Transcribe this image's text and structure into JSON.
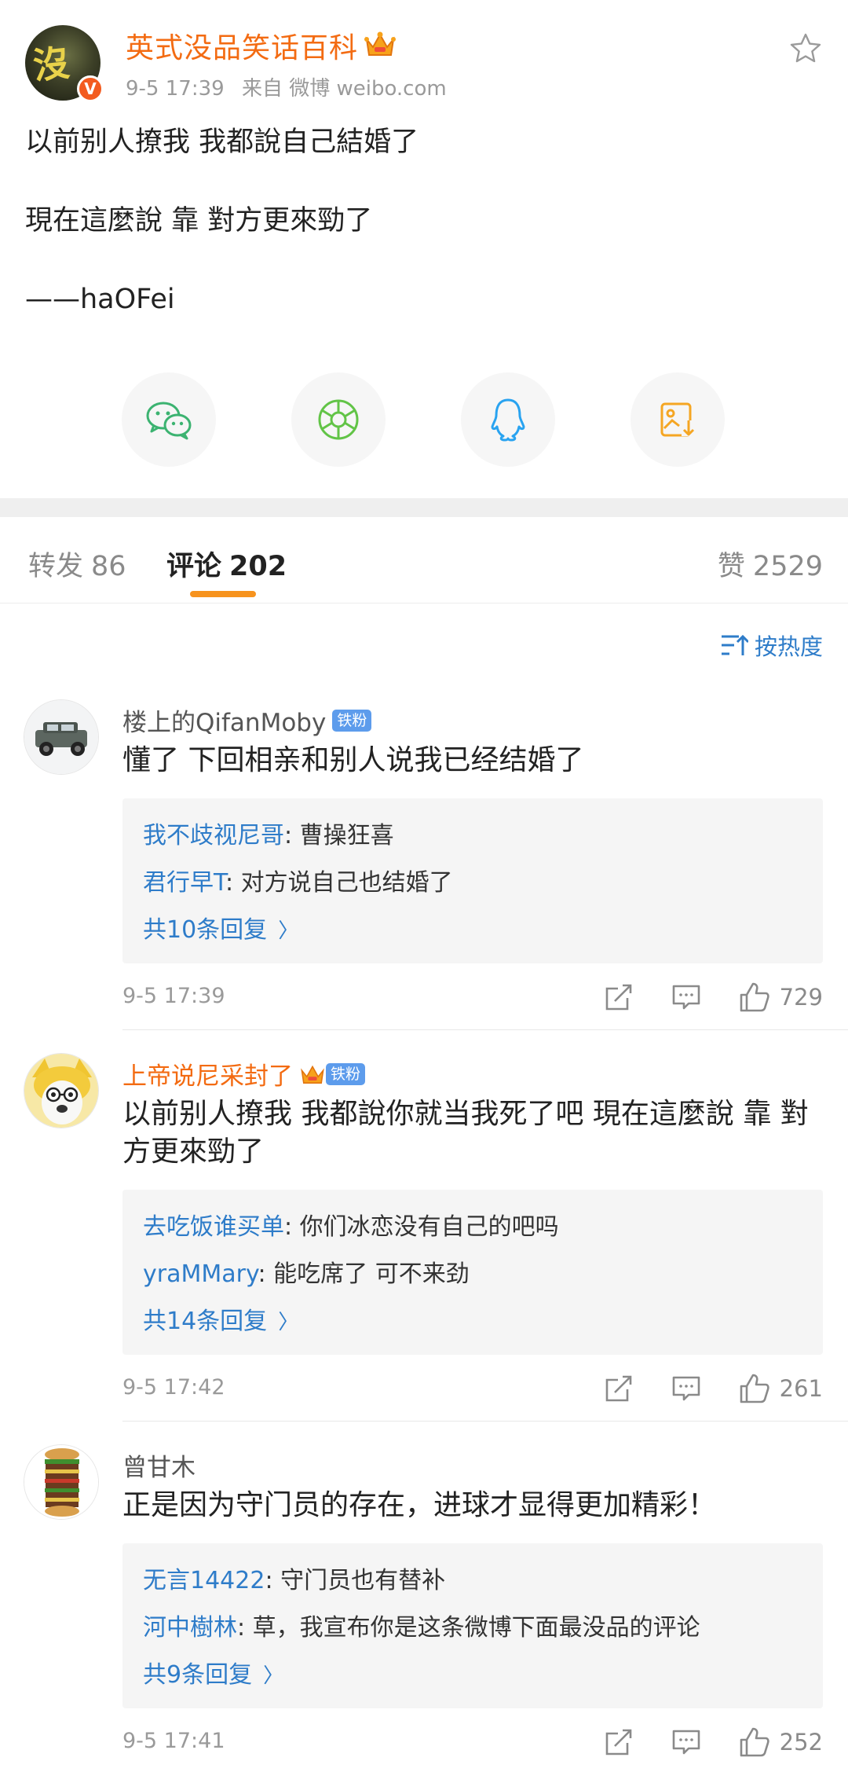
{
  "post": {
    "author": "英式没品笑话百科",
    "verified_mark": "V",
    "time": "9-5 17:39",
    "source": "来自 微博 weibo.com",
    "lines": [
      "以前别人撩我 我都說自己結婚了",
      "現在這麼說 靠 對方更來勁了",
      "——haOFei"
    ],
    "avatar_glyph": "沒",
    "icons": {
      "crown": "crown-icon",
      "star": "star-outline-icon"
    }
  },
  "share": [
    {
      "icon": "wechat-icon",
      "color": "#3cb371"
    },
    {
      "icon": "moments-icon",
      "color": "#62c447"
    },
    {
      "icon": "qq-icon",
      "color": "#29a3f0"
    },
    {
      "icon": "save-image-icon",
      "color": "#f5a623"
    }
  ],
  "tabs": {
    "repost_label": "转发",
    "repost_count": "86",
    "comment_label": "评论",
    "comment_count": "202",
    "like_label": "赞",
    "like_count": "2529"
  },
  "sort_label": "按热度",
  "colors": {
    "accent_orange": "#f7931e",
    "link_blue": "#2e7cc9",
    "name_orange": "#f36b12"
  },
  "comments": [
    {
      "name": "楼上的QifanMoby",
      "badge": "铁粉",
      "text": "懂了 下回相亲和别人说我已经结婚了",
      "replies": [
        {
          "user": "我不歧视尼哥",
          "text": ": 曹操狂喜"
        },
        {
          "user": "君行早T",
          "text": ": 对方说自己也结婚了"
        }
      ],
      "more": "共10条回复",
      "time": "9-5 17:39",
      "likes": "729"
    },
    {
      "name": "上帝说尼采封了",
      "badge": "铁粉",
      "text": "以前别人撩我 我都說你就当我死了吧  現在這麼說 靠 對方更來勁了",
      "replies": [
        {
          "user": "去吃饭谁买单",
          "text": ": 你们冰恋没有自己的吧吗"
        },
        {
          "user": "yraMMary",
          "text": ": 能吃席了 可不来劲"
        }
      ],
      "more": "共14条回复",
      "time": "9-5 17:42",
      "likes": "261"
    },
    {
      "name": "曾甘木",
      "text": "正是因为守门员的存在，进球才显得更加精彩！",
      "replies": [
        {
          "user": "无言14422",
          "text": ": 守门员也有替补"
        },
        {
          "user": "河中樹林",
          "text": ": 草，我宣布你是这条微博下面最没品的评论"
        }
      ],
      "more": "共9条回复",
      "time": "9-5 17:41",
      "likes": "252"
    }
  ]
}
